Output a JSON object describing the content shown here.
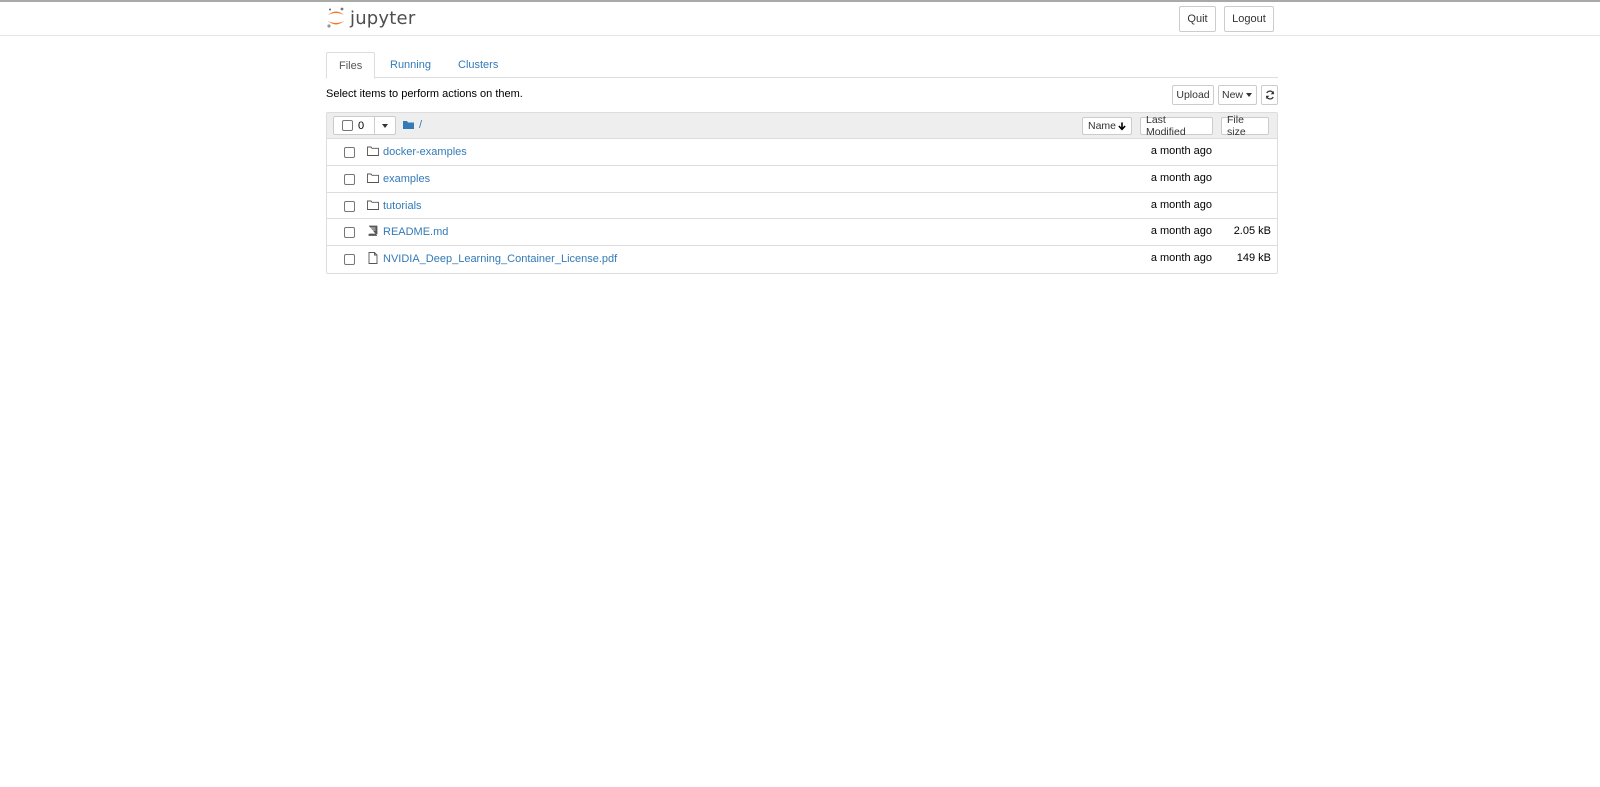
{
  "header": {
    "logo_text": "jupyter",
    "quit_label": "Quit",
    "logout_label": "Logout"
  },
  "tabs": [
    {
      "label": "Files",
      "active": true
    },
    {
      "label": "Running",
      "active": false
    },
    {
      "label": "Clusters",
      "active": false
    }
  ],
  "toolbar": {
    "info_text": "Select items to perform actions on them.",
    "upload_label": "Upload",
    "new_label": "New"
  },
  "list_header": {
    "selected_count": "0",
    "breadcrumb": "/",
    "sort_name_label": "Name",
    "sort_modified_label": "Last Modified",
    "sort_size_label": "File size"
  },
  "files": [
    {
      "name": "docker-examples",
      "type": "folder",
      "modified": "a month ago",
      "size": ""
    },
    {
      "name": "examples",
      "type": "folder",
      "modified": "a month ago",
      "size": ""
    },
    {
      "name": "tutorials",
      "type": "folder",
      "modified": "a month ago",
      "size": ""
    },
    {
      "name": "README.md",
      "type": "book",
      "modified": "a month ago",
      "size": "2.05 kB"
    },
    {
      "name": "NVIDIA_Deep_Learning_Container_License.pdf",
      "type": "file",
      "modified": "a month ago",
      "size": "149 kB"
    }
  ],
  "colors": {
    "link": "#337ab7",
    "logo_orange": "#f37726",
    "header_bg": "#eeeeee"
  }
}
